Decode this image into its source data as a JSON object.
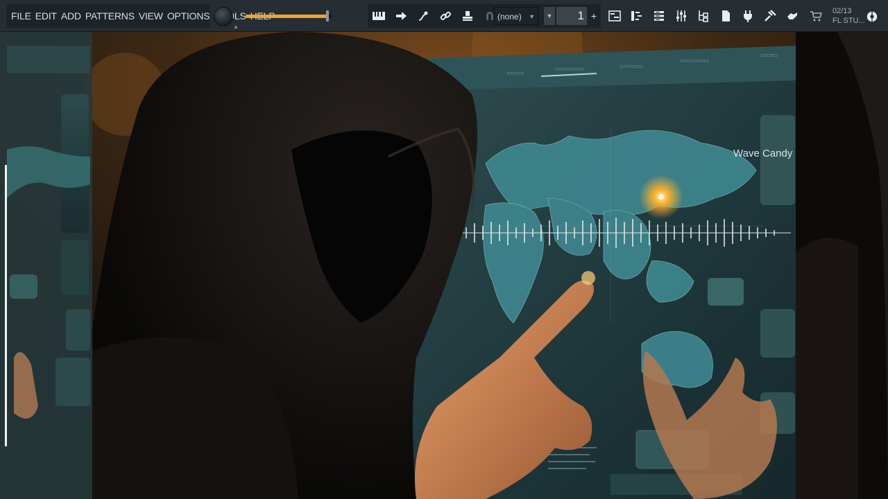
{
  "menu": {
    "items": [
      "FILE",
      "EDIT",
      "ADD",
      "PATTERNS",
      "VIEW",
      "OPTIONS",
      "TOOLS",
      "HELP"
    ]
  },
  "master_volume": {
    "level": 0.95
  },
  "pattern": {
    "selector_value": "(none)",
    "number": "1",
    "plus": "+"
  },
  "hint_panel": {
    "line1": "02/13",
    "line2": "FL STU..."
  },
  "overlay": {
    "wave_candy_label": "Wave Candy"
  },
  "colors": {
    "accent": "#f0a52a",
    "toolbar_bg": "#262d33",
    "panel_bg": "#1d2328",
    "map_teal": "#2f6f76",
    "glow": "#ffb02e"
  },
  "icons": [
    "piano-keys-icon",
    "arrow-right-icon",
    "plug-icon",
    "link-icon",
    "stamp-icon",
    "magnet-icon",
    "playlist-icon",
    "piano-roll-icon",
    "channel-rack-icon",
    "mixer-icon",
    "browser-icon",
    "file-icon",
    "plugin-icon",
    "tools-icon",
    "hand-icon",
    "cart-icon",
    "cpu-icon"
  ]
}
